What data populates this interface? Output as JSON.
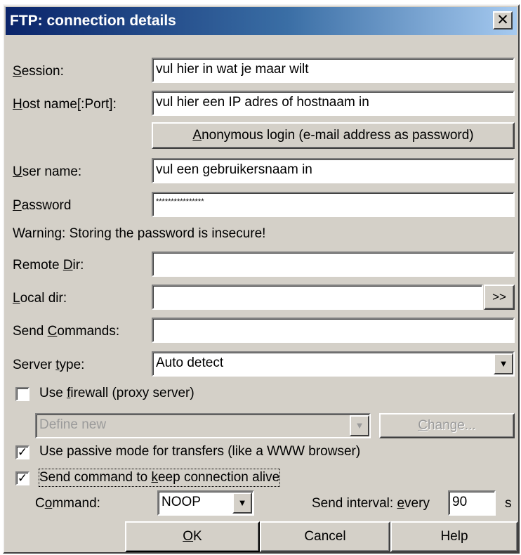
{
  "window": {
    "title": "FTP: connection details",
    "close_glyph": "✕"
  },
  "session": {
    "label_prefix": "",
    "label_key": "S",
    "label_rest": "ession:",
    "value": "vul hier in wat je maar wilt"
  },
  "host": {
    "label_key": "H",
    "label_rest": "ost name[:Port]:",
    "value": "vul hier een IP adres of hostnaam in"
  },
  "anonymous": {
    "label_key": "A",
    "label_rest": "nonymous login (e-mail address as password)"
  },
  "user": {
    "label_key": "U",
    "label_rest": "ser name:",
    "value": "vul een gebruikersnaam in"
  },
  "password": {
    "label_key": "P",
    "label_rest": "assword",
    "value": "****************"
  },
  "warning": "Warning: Storing the password is insecure!",
  "remote_dir": {
    "label_pre": "Remote ",
    "label_key": "D",
    "label_rest": "ir:",
    "value": ""
  },
  "local_dir": {
    "label_key": "L",
    "label_rest": "ocal dir:",
    "value": "",
    "browse_label": ">>"
  },
  "send_commands": {
    "label_pre": "Send ",
    "label_key": "C",
    "label_rest": "ommands:",
    "value": ""
  },
  "server_type": {
    "label_pre": "Server ",
    "label_key": "t",
    "label_rest": "ype:",
    "value": "Auto detect"
  },
  "firewall": {
    "label_pre": "Use ",
    "label_key": "f",
    "label_rest": "irewall (proxy server)",
    "checked": false,
    "proxy_value": "Define new",
    "change_label": "Change...",
    "change_key": "C",
    "change_rest": "hange..."
  },
  "passive": {
    "label": "Use passive mode for transfers (like a WWW browser)",
    "checked": true,
    "check_glyph": "✓"
  },
  "keepalive": {
    "label_pre": "Send command to ",
    "label_key": "k",
    "label_rest": "eep connection alive",
    "checked": true,
    "check_glyph": "✓"
  },
  "command": {
    "label_pre": "C",
    "label_key": "o",
    "label_rest": "mmand:",
    "value": "NOOP"
  },
  "interval": {
    "label_pre": "Send interval: ",
    "label_key": "e",
    "label_rest": "very",
    "value": "90",
    "unit": "s"
  },
  "buttons": {
    "ok_key": "O",
    "ok_rest": "K",
    "cancel": "Cancel",
    "help": "Help"
  },
  "icons": {
    "dropdown_arrow": "▼"
  }
}
